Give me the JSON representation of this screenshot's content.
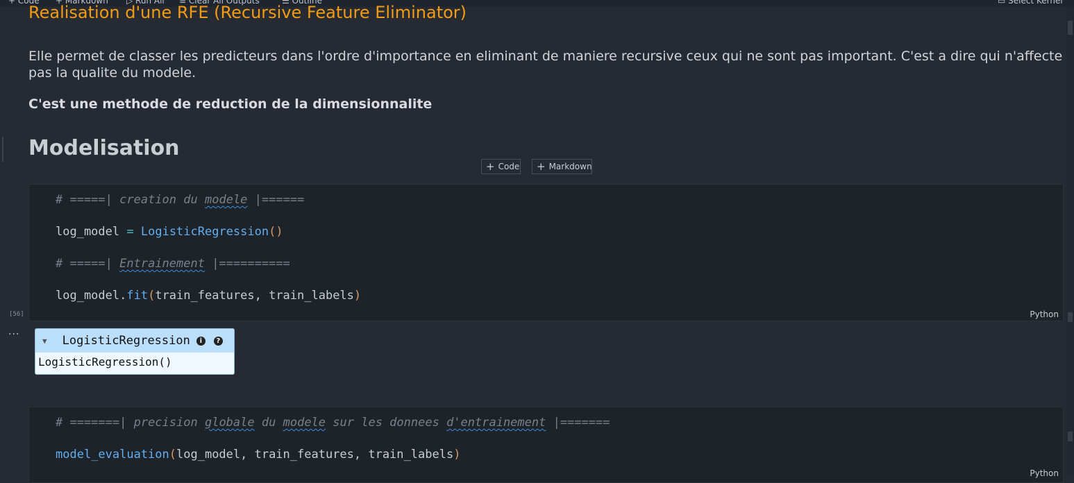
{
  "toolbar": {
    "code": "Code",
    "markdown": "Markdown",
    "run_all": "Run All",
    "clear_outputs": "Clear All Outputs",
    "outline": "Outline",
    "select_kernel": "Select Kernel"
  },
  "markdown_cell": {
    "title": "Realisation d'une RFE (Recursive Feature Eliminator)",
    "paragraph": "Elle permet de classer les predicteurs dans l'ordre d'importance en eliminant de maniere recursive ceux qui ne sont pas important. C'est a dire qui n'affecte pas la qualite du modele.",
    "bold_note": "C'est une methode de reduction de la dimensionnalite",
    "heading": "Modelisation"
  },
  "add_cell": {
    "code_label": "Code",
    "markdown_label": "Markdown"
  },
  "cell1": {
    "line1_prefix": "# =====| ",
    "line1_w1": "creation",
    "line1_w2": "du",
    "line1_w3": "modele",
    "line1_suffix": " |======",
    "line2_var": "log_model",
    "line2_eq": "=",
    "line2_fn": "LogisticRegression",
    "line2_parens": "()",
    "line3_prefix": "# =====| ",
    "line3_word": "Entrainement",
    "line3_suffix": " |==========",
    "line4_obj": "log_model.",
    "line4_fn": "fit",
    "line4_open": "(",
    "line4_args": "train_features, train_labels",
    "line4_close": ")",
    "exec_count": "[56]",
    "language": "Python"
  },
  "output": {
    "ellipsis": "...",
    "estimator_name": "LogisticRegression",
    "info_icon": "i",
    "help_icon": "?",
    "estimator_repr": "LogisticRegression()"
  },
  "cell2": {
    "line1_prefix": "# =======| ",
    "line1_w1": "precision",
    "line1_w2": "globale",
    "line1_w3": "du",
    "line1_w4": "modele",
    "line1_w5": "sur les donnees",
    "line1_w6": "d'entrainement",
    "line1_suffix": " |=======",
    "line2_fn": "model_evaluation",
    "line2_open": "(",
    "line2_args": "log_model, train_features, train_labels",
    "line2_close": ")",
    "language": "Python"
  },
  "colors": {
    "background": "#252a33",
    "title_orange": "#f39c12",
    "function_blue": "#61afef",
    "estimator_header": "#bbdefb"
  }
}
